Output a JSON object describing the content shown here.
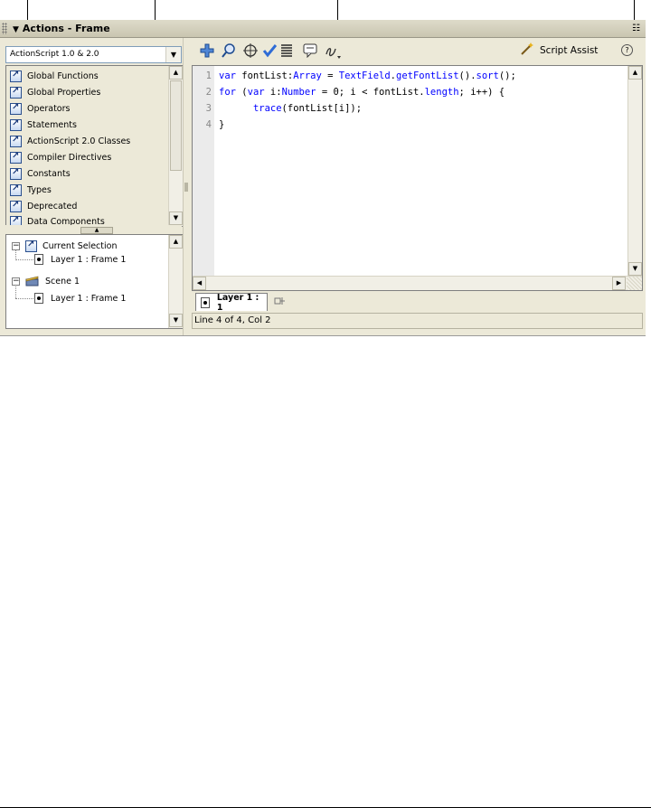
{
  "panel": {
    "title": "Actions - Frame",
    "collapse_glyph": "▼",
    "menu_glyph": "☷"
  },
  "toolbox": {
    "version_select": "ActionScript 1.0 & 2.0",
    "items": [
      {
        "label": "Global Functions"
      },
      {
        "label": "Global Properties"
      },
      {
        "label": "Operators"
      },
      {
        "label": "Statements"
      },
      {
        "label": "ActionScript 2.0 Classes"
      },
      {
        "label": "Compiler Directives"
      },
      {
        "label": "Constants"
      },
      {
        "label": "Types"
      },
      {
        "label": "Deprecated"
      },
      {
        "label": "Data Components"
      }
    ]
  },
  "navigator": {
    "items": [
      {
        "label": "Current Selection",
        "expander": "−"
      },
      {
        "label": "Layer 1 : Frame 1"
      },
      {
        "label": "Scene 1",
        "expander": "−"
      },
      {
        "label": "Layer 1 : Frame 1"
      }
    ]
  },
  "toolbar": {
    "icons": [
      "add-statement-icon",
      "find-icon",
      "target-icon",
      "check-syntax-icon",
      "auto-format-icon",
      "code-hint-icon",
      "debug-options-icon"
    ],
    "script_assist_label": "Script Assist",
    "help_glyph": "?"
  },
  "editor": {
    "line_numbers": [
      "1",
      "2",
      "3",
      "4"
    ],
    "lines": [
      [
        {
          "t": "var",
          "c": "kw"
        },
        {
          "t": " fontList:"
        },
        {
          "t": "Array",
          "c": "kw"
        },
        {
          "t": " = "
        },
        {
          "t": "TextField",
          "c": "kw"
        },
        {
          "t": "."
        },
        {
          "t": "getFontList",
          "c": "kw"
        },
        {
          "t": "()."
        },
        {
          "t": "sort",
          "c": "kw"
        },
        {
          "t": "();"
        }
      ],
      [
        {
          "t": "for",
          "c": "kw"
        },
        {
          "t": " ("
        },
        {
          "t": "var",
          "c": "kw"
        },
        {
          "t": " i:"
        },
        {
          "t": "Number",
          "c": "kw"
        },
        {
          "t": " = 0; i < fontList."
        },
        {
          "t": "length",
          "c": "kw"
        },
        {
          "t": "; i++) {"
        }
      ],
      [
        {
          "t": "      "
        },
        {
          "t": "trace",
          "c": "kw"
        },
        {
          "t": "(fontList[i]);"
        }
      ],
      [
        {
          "t": "}"
        }
      ]
    ]
  },
  "tabs": {
    "active_label": "Layer 1 : 1"
  },
  "status": {
    "text": "Line 4 of 4, Col 2"
  },
  "colors": {
    "keyword": "#0000ff",
    "panel_bg": "#ece9d8"
  }
}
